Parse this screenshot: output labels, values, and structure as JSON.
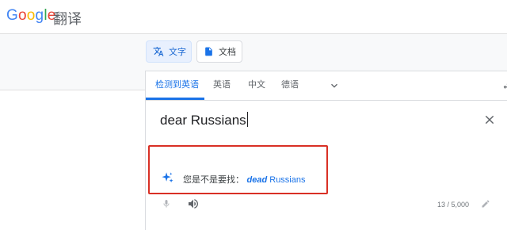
{
  "header": {
    "logo": {
      "g": "G",
      "o1": "o",
      "o2": "o",
      "g2": "g",
      "l": "l",
      "e": "e"
    },
    "product": "翻译"
  },
  "modes": {
    "text_label": "文字",
    "docs_label": "文档",
    "active": "text"
  },
  "languages": {
    "tabs": [
      "检测到英语",
      "英语",
      "中文",
      "德语"
    ],
    "active_index": 0
  },
  "input": {
    "value": "dear Russians"
  },
  "suggestion": {
    "prefix": "您是不是要找：",
    "correction_word": "dead",
    "rest": " Russians"
  },
  "char_count": "13 / 5,000",
  "colors": {
    "accent": "#1a73e8",
    "highlight_box": "#d93025",
    "active_mode_bg": "#e8f0fe"
  },
  "icons": [
    "translate-icon",
    "document-icon",
    "chevron-down-icon",
    "swap-icon",
    "close-icon",
    "sparkle-icon",
    "mic-icon",
    "speaker-icon",
    "pencil-icon"
  ]
}
